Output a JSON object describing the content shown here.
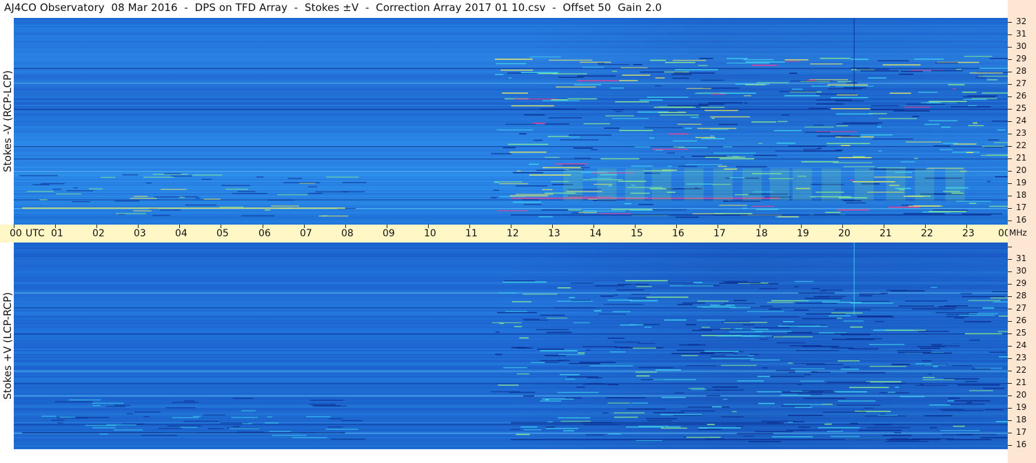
{
  "title": "AJ4CO Observatory  08 Mar 2016  -  DPS on TFD Array  -  Stokes ±V  -  Correction Array 2017 01 10.csv  -  Offset 50  Gain 2.0",
  "chart_data": {
    "type": "heatmap",
    "panels": [
      {
        "name": "Stokes -V (RCP-LCP)",
        "ylabel": "Stokes -V (RCP-LCP)",
        "ylim": [
          16,
          32
        ]
      },
      {
        "name": "Stokes +V (LCP-RCP)",
        "ylabel": "Stokes +V (LCP-RCP)",
        "ylim": [
          16,
          32
        ]
      }
    ],
    "x_axis": {
      "unit_label": "UTC",
      "ticks": [
        "00",
        "01",
        "02",
        "03",
        "04",
        "05",
        "06",
        "07",
        "08",
        "09",
        "10",
        "11",
        "12",
        "13",
        "14",
        "15",
        "16",
        "17",
        "18",
        "19",
        "20",
        "21",
        "22",
        "23",
        "00"
      ],
      "range_hours": [
        0,
        24
      ]
    },
    "y_axis": {
      "unit_label": "MHz",
      "ticks": [
        "16",
        "17",
        "18",
        "19",
        "20",
        "21",
        "22",
        "23",
        "24",
        "25",
        "26",
        "27",
        "28",
        "29",
        "30",
        "31",
        "32"
      ],
      "range_mhz": [
        16,
        32
      ]
    },
    "colormap": [
      "#0a2a8c",
      "#1d5fd0",
      "#2e90ec",
      "#40d8f0",
      "#8cf090",
      "#f0f060",
      "#ff3c8c"
    ]
  }
}
